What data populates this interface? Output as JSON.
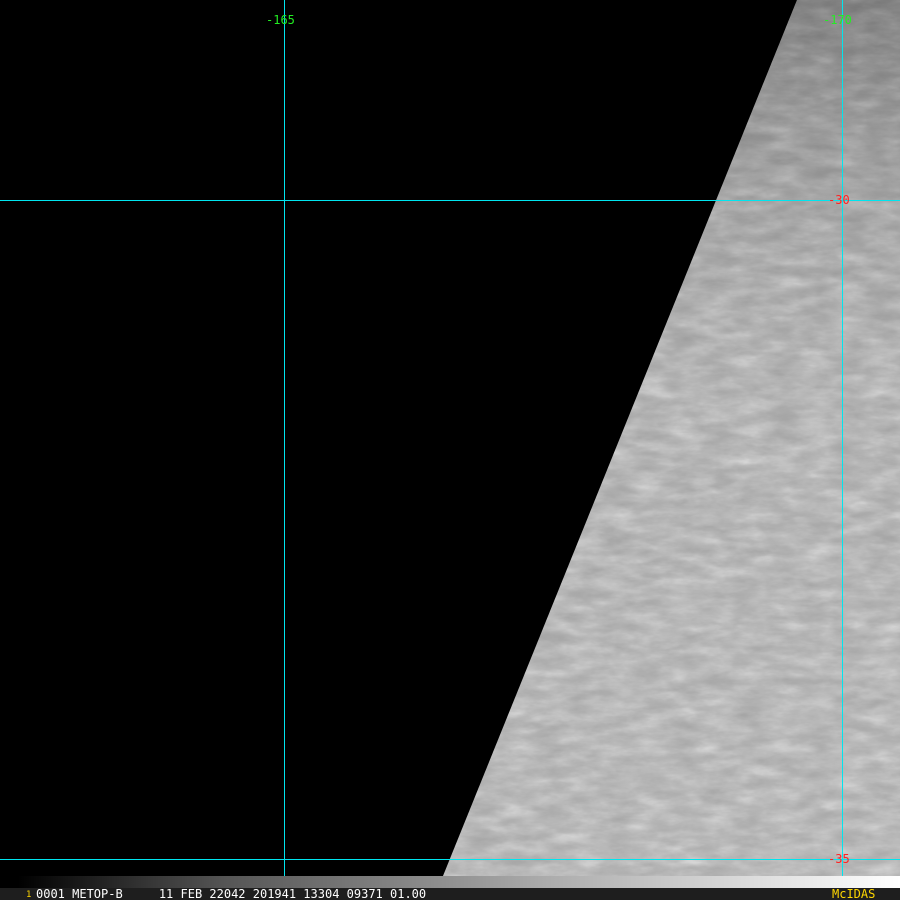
{
  "grid": {
    "longitudes": [
      "-165",
      "-170"
    ],
    "latitudes": [
      "-30",
      "-35"
    ]
  },
  "footer": {
    "frame": "1",
    "info": "0001 METOP-B     11 FEB 22042 201941 13304 09371 01.00",
    "brand": "McIDAS"
  },
  "colors": {
    "grid": "#00e5ee",
    "lon_label": "#22ee22",
    "lat_label": "#ff2222",
    "brand": "#ffd700"
  }
}
